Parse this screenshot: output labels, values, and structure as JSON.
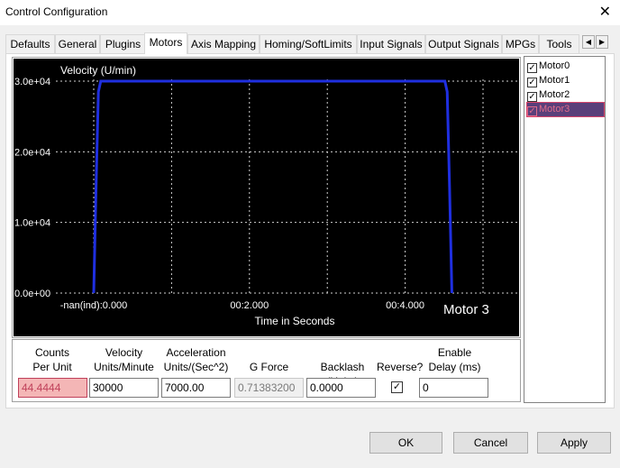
{
  "window": {
    "title": "Control Configuration",
    "close": "✕"
  },
  "tabs": [
    "Defaults",
    "General",
    "Plugins",
    "Motors",
    "Axis Mapping",
    "Homing/SoftLimits",
    "Input Signals",
    "Output Signals",
    "MPGs",
    "Tools"
  ],
  "active_tab": "Motors",
  "tab_scroll": {
    "left": "◀",
    "right": "▶"
  },
  "motors": [
    {
      "label": "Motor0",
      "checked": true
    },
    {
      "label": "Motor1",
      "checked": true
    },
    {
      "label": "Motor2",
      "checked": true
    },
    {
      "label": "Motor3",
      "checked": true,
      "selected": true
    }
  ],
  "chart_data": {
    "type": "line",
    "title": "Velocity (U/min)",
    "xlabel": "Time in Seconds",
    "annotation": "Motor 3",
    "y_ticks": [
      "3.0e+04",
      "2.0e+04",
      "1.0e+04",
      "0.0e+00"
    ],
    "x_ticks": [
      "-nan(ind):0.000",
      "00:2.000",
      "00:4.000"
    ],
    "ylim": [
      0,
      30000
    ],
    "xlim": [
      0,
      5.0
    ],
    "grid": true,
    "series": [
      {
        "x": [
          0.0,
          0.03,
          0.06,
          0.09,
          4.51,
          4.54,
          4.57,
          4.6
        ],
        "y": [
          0,
          15000,
          28500,
          30000,
          30000,
          28500,
          15000,
          0
        ],
        "color": "#1f2fe0"
      }
    ],
    "background": "#000000"
  },
  "params": {
    "counts": {
      "label1": "Counts",
      "label2": "Per Unit",
      "value": "44.4444"
    },
    "velocity": {
      "label1": "Velocity",
      "label2": "Units/Minute",
      "value": "30000"
    },
    "accel": {
      "label1": "Acceleration",
      "label2": "Units/(Sec^2)",
      "value": "7000.00"
    },
    "gforce": {
      "label": "G Force",
      "value": "0.71383200"
    },
    "backlash": {
      "label": "Backlash (Units)",
      "value": "0.0000"
    },
    "reverse": {
      "label": "Reverse?",
      "checked": true
    },
    "delay": {
      "label1": "Enable",
      "label2": "Delay (ms)",
      "value": "0"
    }
  },
  "buttons": {
    "ok": "OK",
    "cancel": "Cancel",
    "apply": "Apply"
  }
}
